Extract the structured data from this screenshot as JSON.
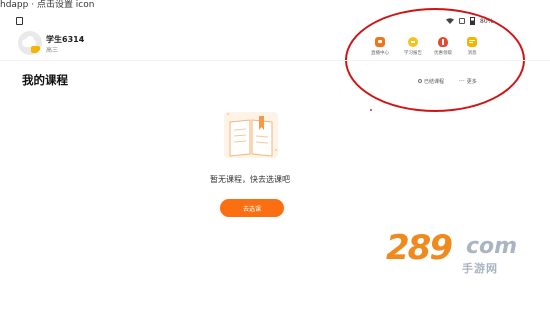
{
  "caption": "hdapp · 点击设置 icon",
  "profile": {
    "name": "学生6314",
    "chevron": "›",
    "grade": "高三"
  },
  "status_bar": {
    "battery": "80%"
  },
  "quick_actions": [
    {
      "label": "直播中心",
      "icon": "live-tv-icon",
      "color": "#f2731a"
    },
    {
      "label": "学习报告",
      "icon": "report-icon",
      "color": "#f5c21b"
    },
    {
      "label": "优惠领取",
      "icon": "gift-icon",
      "color": "#e8492e"
    },
    {
      "label": "消息",
      "icon": "message-icon",
      "color": "#f5b400"
    }
  ],
  "main": {
    "title": "我的课程",
    "pill_history": "已结课程",
    "pill_more": "更多",
    "empty_text": "暂无课程，快去选课吧",
    "select_button": "去选课"
  },
  "watermark": {
    "number": "289",
    "domain": "com",
    "sub": "手游网"
  },
  "colors": {
    "accent": "#fb6e12",
    "annotation": "#d21313"
  }
}
